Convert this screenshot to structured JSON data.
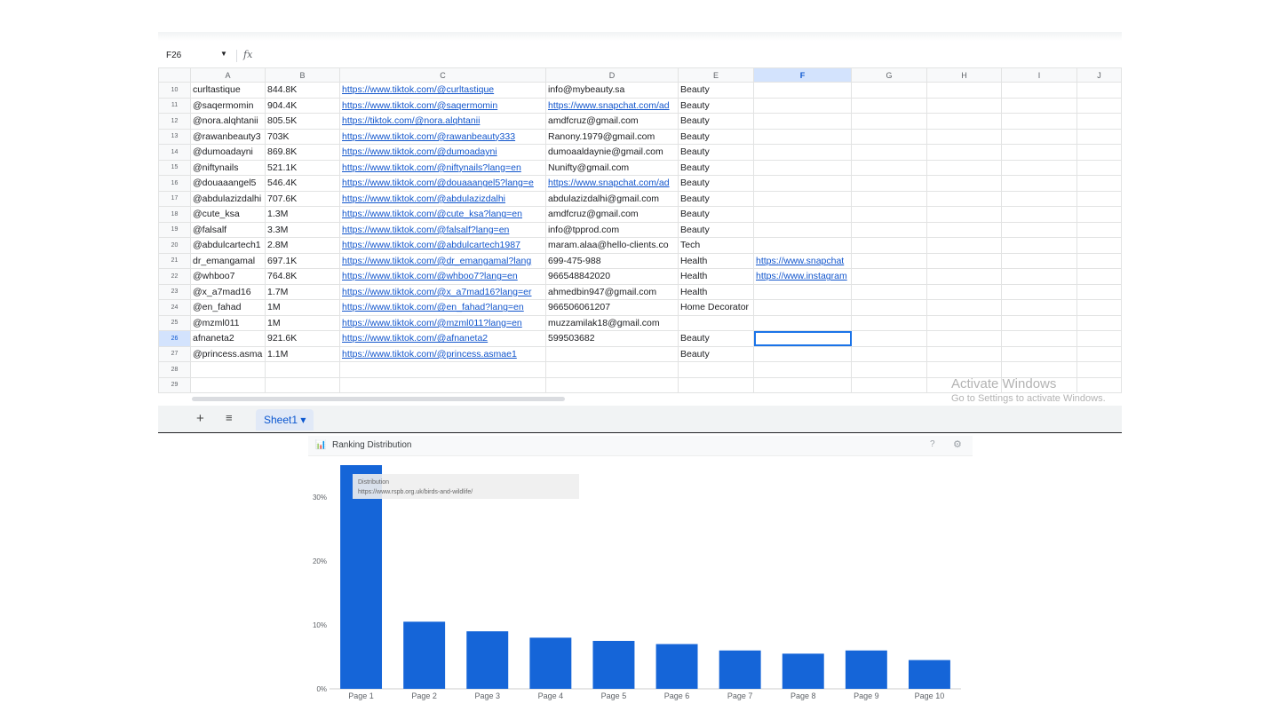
{
  "formula_bar": {
    "cell_ref": "F26",
    "fx_label": "fx"
  },
  "columns": [
    "A",
    "B",
    "C",
    "D",
    "E",
    "F",
    "G",
    "H",
    "I",
    "J"
  ],
  "rows": [
    {
      "n": "10",
      "a": "curltastique",
      "b": "844.8K",
      "c": "https://www.tiktok.com/@curltastique",
      "d": "info@mybeauty.sa",
      "e": "Beauty",
      "f": ""
    },
    {
      "n": "11",
      "a": "@saqermomin",
      "b": "904.4K",
      "c": "https://www.tiktok.com/@saqermomin",
      "d": "https://www.snapchat.com/ad",
      "e": "Beauty",
      "f": ""
    },
    {
      "n": "12",
      "a": "@nora.alqhtanii",
      "b": "805.5K",
      "c": "https://tiktok.com/@nora.alqhtanii",
      "d": "amdfcruz@gmail.com",
      "e": "Beauty",
      "f": ""
    },
    {
      "n": "13",
      "a": "@rawanbeauty3",
      "b": "703K",
      "c": "https://www.tiktok.com/@rawanbeauty333",
      "d": "Ranony.1979@gmail.com",
      "e": "Beauty",
      "f": ""
    },
    {
      "n": "14",
      "a": "@dumoadayni",
      "b": "869.8K",
      "c": "https://www.tiktok.com/@dumoadayni",
      "d": "dumoaaldaynie@gmail.com",
      "e": "Beauty",
      "f": ""
    },
    {
      "n": "15",
      "a": "@niftynails",
      "b": "521.1K",
      "c": "https://www.tiktok.com/@niftynails?lang=en",
      "d": "Nunifty@gmail.com",
      "e": "Beauty",
      "f": ""
    },
    {
      "n": "16",
      "a": "@douaaangel5",
      "b": "546.4K",
      "c": "https://www.tiktok.com/@douaaangel5?lang=e",
      "d": "https://www.snapchat.com/ad",
      "e": "Beauty",
      "f": ""
    },
    {
      "n": "17",
      "a": "@abdulazizdalhi",
      "b": "707.6K",
      "c": "https://www.tiktok.com/@abdulazizdalhi",
      "d": "abdulazizdalhi@gmail.com",
      "e": "Beauty",
      "f": ""
    },
    {
      "n": "18",
      "a": "@cute_ksa",
      "b": "1.3M",
      "c": "https://www.tiktok.com/@cute_ksa?lang=en",
      "d": "amdfcruz@gmail.com",
      "e": "Beauty",
      "f": ""
    },
    {
      "n": "19",
      "a": "@falsalf",
      "b": "3.3M",
      "c": "https://www.tiktok.com/@falsalf?lang=en",
      "d": "info@tpprod.com",
      "e": "Beauty",
      "f": ""
    },
    {
      "n": "20",
      "a": "@abdulcartech1",
      "b": "2.8M",
      "c": "https://www.tiktok.com/@abdulcartech1987",
      "d": "maram.alaa@hello-clients.co",
      "e": "Tech",
      "f": ""
    },
    {
      "n": "21",
      "a": "dr_emangamal",
      "b": "697.1K",
      "c": "https://www.tiktok.com/@dr_emangamal?lang",
      "d": "699-475-988",
      "e": "Health",
      "f": "https://www.snapchat"
    },
    {
      "n": "22",
      "a": "@whboo7",
      "b": "764.8K",
      "c": "https://www.tiktok.com/@whboo7?lang=en",
      "d": "966548842020",
      "e": "Health",
      "f": "https://www.instagram"
    },
    {
      "n": "23",
      "a": "@x_a7mad16",
      "b": "1.7M",
      "c": "https://www.tiktok.com/@x_a7mad16?lang=er",
      "d": "ahmedbin947@gmail.com",
      "e": "Health",
      "f": ""
    },
    {
      "n": "24",
      "a": "@en_fahad",
      "b": "1M",
      "c": "https://www.tiktok.com/@en_fahad?lang=en",
      "d": "966506061207",
      "e": "Home Decorator",
      "f": ""
    },
    {
      "n": "25",
      "a": "@mzml011",
      "b": "1M",
      "c": "https://www.tiktok.com/@mzml011?lang=en",
      "d": "muzzamilak18@gmail.com",
      "e": "",
      "f": ""
    },
    {
      "n": "26",
      "a": "afnaneta2",
      "b": "921.6K",
      "c": "https://www.tiktok.com/@afnaneta2",
      "d": "599503682",
      "e": "Beauty",
      "f": ""
    },
    {
      "n": "27",
      "a": "@princess.asma",
      "b": "1.1M",
      "c": "https://www.tiktok.com/@princess.asmae1",
      "d": "",
      "e": "Beauty",
      "f": ""
    },
    {
      "n": "28",
      "a": "",
      "b": "",
      "c": "",
      "d": "",
      "e": "",
      "f": ""
    },
    {
      "n": "29",
      "a": "",
      "b": "",
      "c": "",
      "d": "",
      "e": "",
      "f": ""
    }
  ],
  "sheet_tabs": {
    "add_label": "+",
    "menu_label": "≡",
    "active_sheet": "Sheet1 ▾"
  },
  "watermark": {
    "line1": "Activate Windows",
    "line2": "Go to Settings to activate Windows."
  },
  "chart_panel": {
    "title": "Ranking Distribution",
    "help": "?",
    "settings": "⚙"
  },
  "colors": {
    "bar": "#1565d8",
    "link": "#1155cc",
    "selection": "#1a73e8"
  },
  "chart_data": {
    "type": "bar",
    "title": "",
    "xlabel": "",
    "ylabel": "",
    "categories": [
      "Page 1",
      "Page 2",
      "Page 3",
      "Page 4",
      "Page 5",
      "Page 6",
      "Page 7",
      "Page 8",
      "Page 9",
      "Page 10"
    ],
    "series": [
      {
        "values": [
          35,
          10.5,
          9,
          8,
          7.5,
          7,
          6,
          5.5,
          6,
          4.5
        ]
      }
    ],
    "ylim": [
      0,
      35
    ],
    "yticks": [
      "0%",
      "10%",
      "20%",
      "30%"
    ],
    "grid": false,
    "tooltip": {
      "label": "Distribution",
      "value": "https://www.rspb.org.uk/birds-and-wildlife/"
    }
  }
}
